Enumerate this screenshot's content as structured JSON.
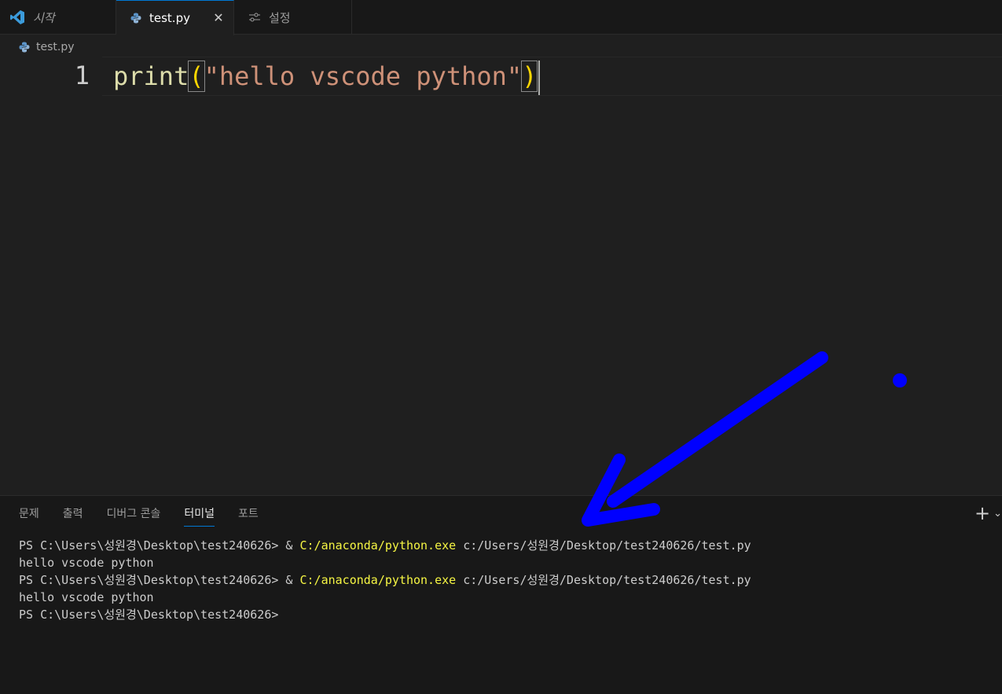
{
  "tabs": {
    "start": {
      "label": "시작"
    },
    "file": {
      "label": "test.py",
      "close": "✕"
    },
    "settings": {
      "label": "설정"
    }
  },
  "breadcrumb": {
    "file": "test.py"
  },
  "editor": {
    "line_number": "1",
    "code": {
      "fn": "print",
      "open_paren": "(",
      "string": "\"hello vscode python\"",
      "close_paren": ")"
    }
  },
  "panel": {
    "tabs": [
      "문제",
      "출력",
      "디버그 콘솔",
      "터미널",
      "포트"
    ],
    "active_tab": "터미널",
    "add_label": "+",
    "dropdown_label": "⌄"
  },
  "terminal": {
    "lines": [
      {
        "prompt": "PS C:\\Users\\성원경\\Desktop\\test240626> & ",
        "exe": "C:/anaconda/python.exe",
        "args": " c:/Users/성원경/Desktop/test240626/test.py"
      },
      {
        "text": "hello vscode python"
      },
      {
        "prompt": "PS C:\\Users\\성원경\\Desktop\\test240626> & ",
        "exe": "C:/anaconda/python.exe",
        "args": " c:/Users/성원경/Desktop/test240626/test.py"
      },
      {
        "text": "hello vscode python"
      },
      {
        "prompt": "PS C:\\Users\\성원경\\Desktop\\test240626>"
      }
    ]
  },
  "colors": {
    "annotation": "#0000ff",
    "accent": "#0078d4",
    "exe_highlight": "#f5f543"
  }
}
